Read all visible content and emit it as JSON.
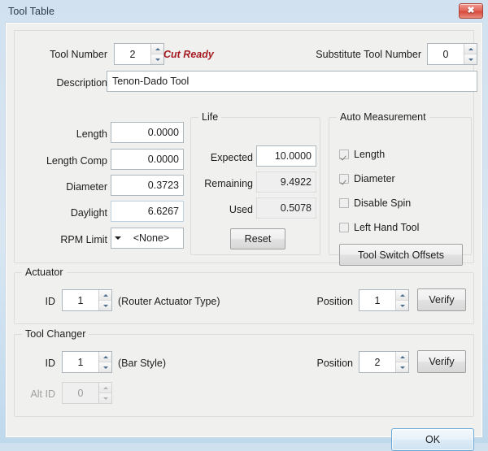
{
  "window": {
    "title": "Tool Table",
    "close_label": "✖"
  },
  "tool": {
    "tool_number_label": "Tool Number",
    "tool_number_value": "2",
    "status": "Cut Ready",
    "substitute_label": "Substitute Tool Number",
    "substitute_value": "0",
    "description_label": "Description",
    "description_value": "Tenon-Dado Tool",
    "length_label": "Length",
    "length_value": "0.0000",
    "length_comp_label": "Length Comp",
    "length_comp_value": "0.0000",
    "diameter_label": "Diameter",
    "diameter_value": "0.3723",
    "daylight_label": "Daylight",
    "daylight_value": "6.6267",
    "rpm_limit_label": "RPM Limit",
    "rpm_limit_value": "<None>"
  },
  "life": {
    "title": "Life",
    "expected_label": "Expected",
    "expected_value": "10.0000",
    "remaining_label": "Remaining",
    "remaining_value": "9.4922",
    "used_label": "Used",
    "used_value": "0.5078",
    "reset_label": "Reset"
  },
  "auto_measurement": {
    "title": "Auto Measurement",
    "items": [
      {
        "label": "Length",
        "checked": true
      },
      {
        "label": "Diameter",
        "checked": true
      },
      {
        "label": "Disable Spin",
        "checked": false
      },
      {
        "label": "Left Hand Tool",
        "checked": false
      }
    ],
    "tool_switch_offsets_label": "Tool Switch Offsets"
  },
  "actuator": {
    "title": "Actuator",
    "id_label": "ID",
    "id_value": "1",
    "type_note": "(Router Actuator Type)",
    "position_label": "Position",
    "position_value": "1",
    "verify_label": "Verify"
  },
  "tool_changer": {
    "title": "Tool Changer",
    "id_label": "ID",
    "id_value": "1",
    "type_note": "(Bar Style)",
    "alt_id_label": "Alt ID",
    "alt_id_value": "0",
    "position_label": "Position",
    "position_value": "2",
    "verify_label": "Verify"
  },
  "footer": {
    "ok_label": "OK"
  },
  "colors": {
    "status_red": "#a51c22",
    "default_button_border": "#69a8d4",
    "panel_bg": "#f0f0ef",
    "close_button": "#d84a3c"
  }
}
